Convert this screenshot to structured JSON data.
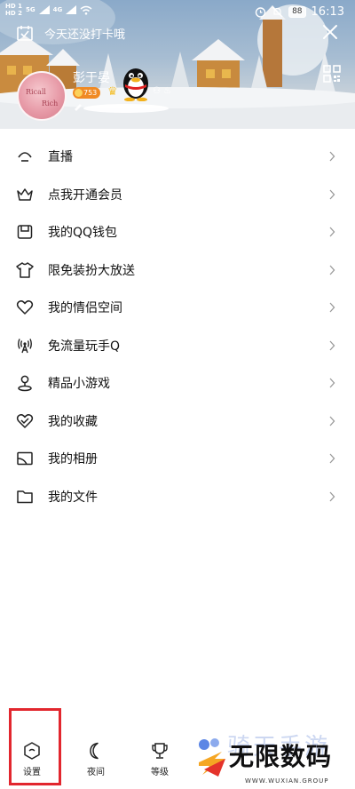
{
  "status_bar": {
    "sim1": "HD 1",
    "sim2": "HD 2",
    "net1": "5G",
    "net2": "4G",
    "battery": "88",
    "time": "16:13"
  },
  "header": {
    "checkin_text": "今天还没打卡哦",
    "nickname": "彭于晏",
    "level": "753",
    "avatar_text": [
      "Ricall",
      "Rich"
    ],
    "mini_icons": "⚇ ♨",
    "icons": {
      "checkin": "calendar-check-icon",
      "close": "close-icon",
      "qr": "qr-code-icon"
    }
  },
  "menu": [
    {
      "label": "直播",
      "icon": "live-icon"
    },
    {
      "label": "点我开通会员",
      "icon": "crown-icon"
    },
    {
      "label": "我的QQ钱包",
      "icon": "wallet-icon"
    },
    {
      "label": "限免装扮大放送",
      "icon": "tshirt-icon"
    },
    {
      "label": "我的情侣空间",
      "icon": "heart-icon"
    },
    {
      "label": "免流量玩手Q",
      "icon": "antenna-icon"
    },
    {
      "label": "精品小游戏",
      "icon": "game-icon"
    },
    {
      "label": "我的收藏",
      "icon": "favorite-heart-icon"
    },
    {
      "label": "我的相册",
      "icon": "album-icon"
    },
    {
      "label": "我的文件",
      "icon": "folder-icon"
    }
  ],
  "bottom_bar": {
    "settings_label": "设置",
    "night_label": "夜间",
    "level_label": "等级"
  },
  "watermark": {
    "faded_text": "骑天手游",
    "main_text": "无限数码",
    "sub_text": "WWW.WUXIAN.GROUP"
  },
  "colors": {
    "highlight": "#e2262e",
    "level_badge": "#f08a24",
    "icon_stroke": "#222222",
    "chevron": "#9a9a9a"
  }
}
